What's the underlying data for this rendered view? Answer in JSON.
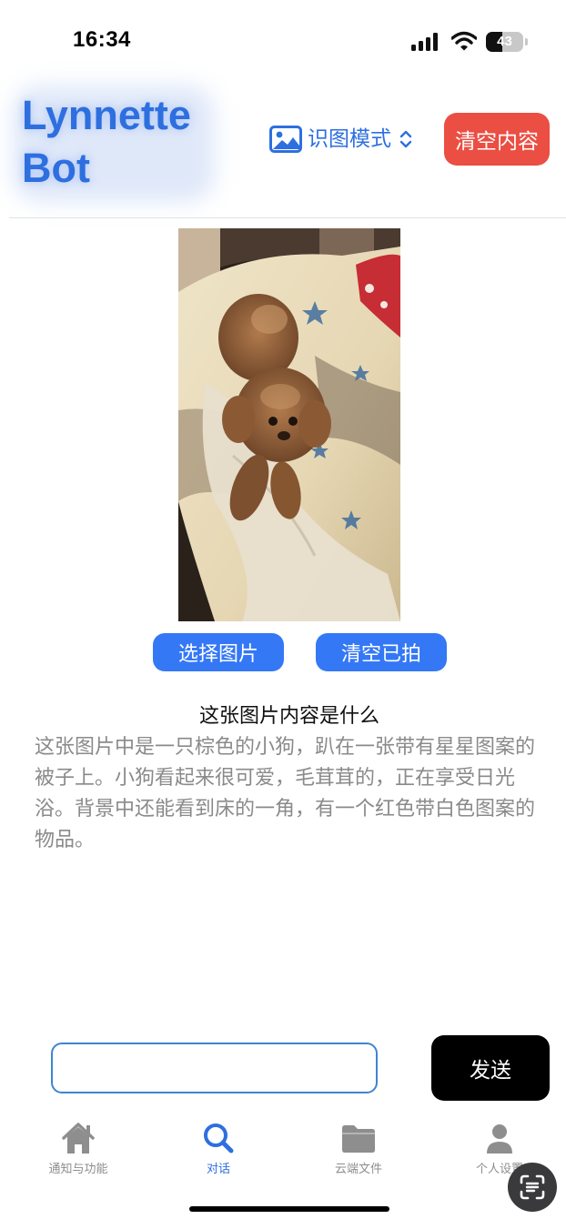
{
  "status_bar": {
    "time": "16:34",
    "battery_level": "43",
    "battery_fraction": 0.43,
    "icons": [
      "signal-icon",
      "wifi-icon",
      "battery-icon"
    ]
  },
  "header": {
    "title": "Lynnette Bot",
    "mode_label": "识图模式",
    "mode_icon": "photo-icon",
    "mode_chevron_icon": "chevron-up-down-icon",
    "clear_button": "清空内容"
  },
  "image_panel": {
    "photo_alt": "A small brown poodle lying on a starred quilt in sunlight",
    "choose_button": "选择图片",
    "clear_taken_button": "清空已拍"
  },
  "conversation": {
    "question": "这张图片内容是什么",
    "answer": "这张图片中是一只棕色的小狗，趴在一张带有星星图案的被子上。小狗看起来很可爱，毛茸茸的，正在享受日光浴。背景中还能看到床的一角，有一个红色带白色图案的物品。"
  },
  "input_bar": {
    "value": "",
    "placeholder": "",
    "send_button": "发送"
  },
  "tab_bar": {
    "items": [
      {
        "label": "通知与功能",
        "icon": "home-icon",
        "active": false
      },
      {
        "label": "对话",
        "icon": "search-icon",
        "active": true
      },
      {
        "label": "云端文件",
        "icon": "folder-icon",
        "active": false
      },
      {
        "label": "个人设置",
        "icon": "person-icon",
        "active": false
      }
    ]
  },
  "overlay": {
    "scan_icon": "scan-text-icon"
  },
  "colors": {
    "accent": "#2e6fe0",
    "button_blue": "#3478f6",
    "danger": "#eb4e42",
    "send_bg": "#000000",
    "tab_inactive": "#8e8e8e",
    "answer_text": "#8a8a8a"
  }
}
